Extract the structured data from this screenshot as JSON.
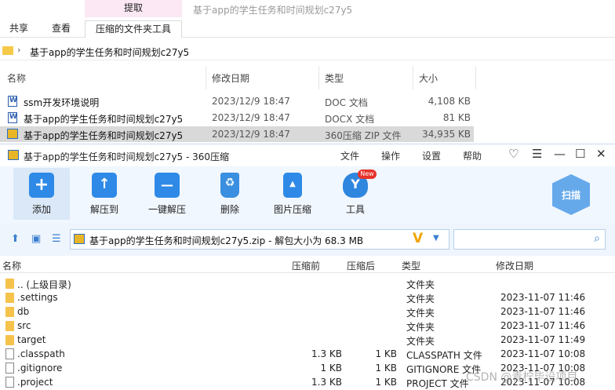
{
  "explorer": {
    "window_title": "基于app的学生任务和时间规划c27y5",
    "context_tab": "提取",
    "ribbon_tabs": {
      "share": "共享",
      "view": "查看",
      "tools": "压缩的文件夹工具"
    },
    "address_path": "基于app的学生任务和时间规划c27y5",
    "columns": {
      "name": "名称",
      "modified": "修改日期",
      "type": "类型",
      "size": "大小"
    },
    "files": [
      {
        "name": "ssm开发环境说明",
        "modified": "2023/12/9 18:47",
        "type": "DOC 文档",
        "size": "4,108 KB"
      },
      {
        "name": "基于app的学生任务和时间规划c27y5",
        "modified": "2023/12/9 18:47",
        "type": "DOCX 文档",
        "size": "81 KB"
      },
      {
        "name": "基于app的学生任务和时间规划c27y5",
        "modified": "2023/12/9 18:47",
        "type": "360压缩 ZIP 文件",
        "size": "34,935 KB"
      }
    ]
  },
  "zip_app": {
    "title": "基于app的学生任务和时间规划c27y5 - 360压缩",
    "menu": {
      "file": "文件",
      "operate": "操作",
      "settings": "设置",
      "help": "帮助"
    },
    "controls": {
      "skin": "♡",
      "menu": "☰",
      "minimize": "—",
      "maximize": "☐",
      "close": "✕"
    },
    "toolbar": {
      "add": "添加",
      "extract_to": "解压到",
      "one_click": "一键解压",
      "delete": "删除",
      "image_compress": "图片压缩",
      "tools": "工具",
      "new_badge": "New",
      "scan": "扫描"
    },
    "path_text": "基于app的学生任务和时间规划c27y5.zip - 解包大小为 68.3 MB",
    "path_mark": "V",
    "list_columns": {
      "name": "名称",
      "compressed_before": "压缩前",
      "compressed_after": "压缩后",
      "type": "类型",
      "modified": "修改日期"
    },
    "entries": [
      {
        "name": ".. (上级目录)",
        "before": "",
        "after": "",
        "type": "文件夹",
        "date": "",
        "kind": "folder"
      },
      {
        "name": ".settings",
        "before": "",
        "after": "",
        "type": "文件夹",
        "date": "2023-11-07 11:46",
        "kind": "folder"
      },
      {
        "name": "db",
        "before": "",
        "after": "",
        "type": "文件夹",
        "date": "2023-11-07 11:46",
        "kind": "folder"
      },
      {
        "name": "src",
        "before": "",
        "after": "",
        "type": "文件夹",
        "date": "2023-11-07 11:46",
        "kind": "folder"
      },
      {
        "name": "target",
        "before": "",
        "after": "",
        "type": "文件夹",
        "date": "2023-11-07 11:49",
        "kind": "folder"
      },
      {
        "name": ".classpath",
        "before": "1.3 KB",
        "after": "1 KB",
        "type": "CLASSPATH 文件",
        "date": "2023-11-07 10:08",
        "kind": "file"
      },
      {
        "name": ".gitignore",
        "before": "1 KB",
        "after": "1 KB",
        "type": "GITIGNORE 文件",
        "date": "2023-11-07 10:08",
        "kind": "file"
      },
      {
        "name": ".project",
        "before": "1.3 KB",
        "after": "1 KB",
        "type": "PROJECT 文件",
        "date": "2023-11-07 10:08",
        "kind": "file"
      }
    ]
  },
  "watermark": "CSDN @青柠毕设项目"
}
